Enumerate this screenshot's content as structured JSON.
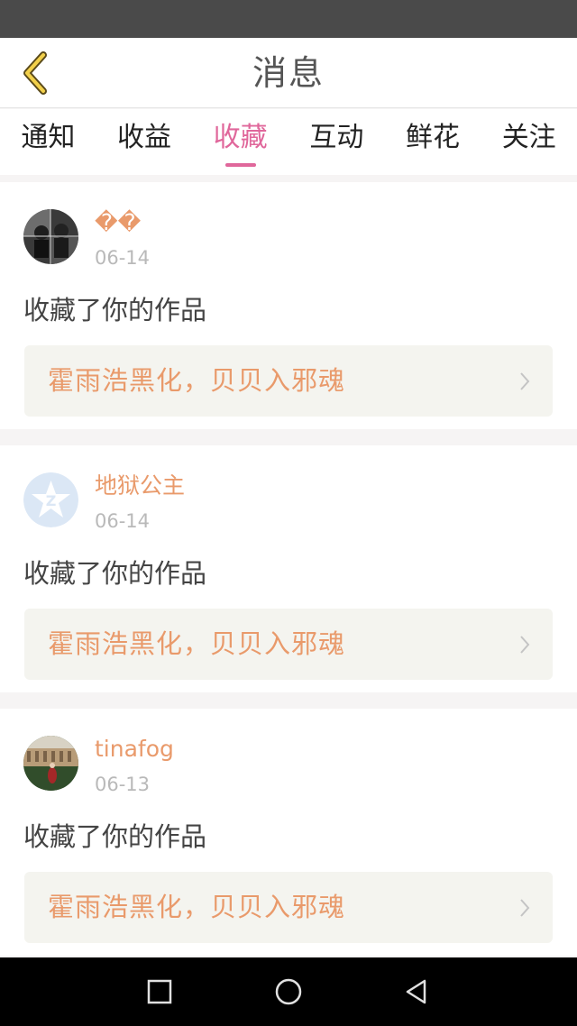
{
  "header": {
    "title": "消息",
    "back_icon": "chevron-left-icon",
    "accent_color": "#e0679b"
  },
  "tabs": [
    {
      "label": "通知",
      "active": false
    },
    {
      "label": "收益",
      "active": false
    },
    {
      "label": "收藏",
      "active": true
    },
    {
      "label": "互动",
      "active": false
    },
    {
      "label": "鲜花",
      "active": false
    },
    {
      "label": "关注",
      "active": false
    }
  ],
  "messages": [
    {
      "username": "��",
      "date": "06-14",
      "action": "收藏了你的作品",
      "work_title": "霍雨浩黑化，贝贝入邪魂",
      "avatar": "photo-avatar"
    },
    {
      "username": "地狱公主",
      "date": "06-14",
      "action": "收藏了你的作品",
      "work_title": "霍雨浩黑化，贝贝入邪魂",
      "avatar": "qzone-star-avatar"
    },
    {
      "username": "tinafog",
      "date": "06-13",
      "action": "收藏了你的作品",
      "work_title": "霍雨浩黑化，贝贝入邪魂",
      "avatar": "palace-photo-avatar"
    }
  ],
  "nav_bar": {
    "buttons": [
      "recent-apps-icon",
      "home-icon",
      "back-triangle-icon"
    ]
  }
}
